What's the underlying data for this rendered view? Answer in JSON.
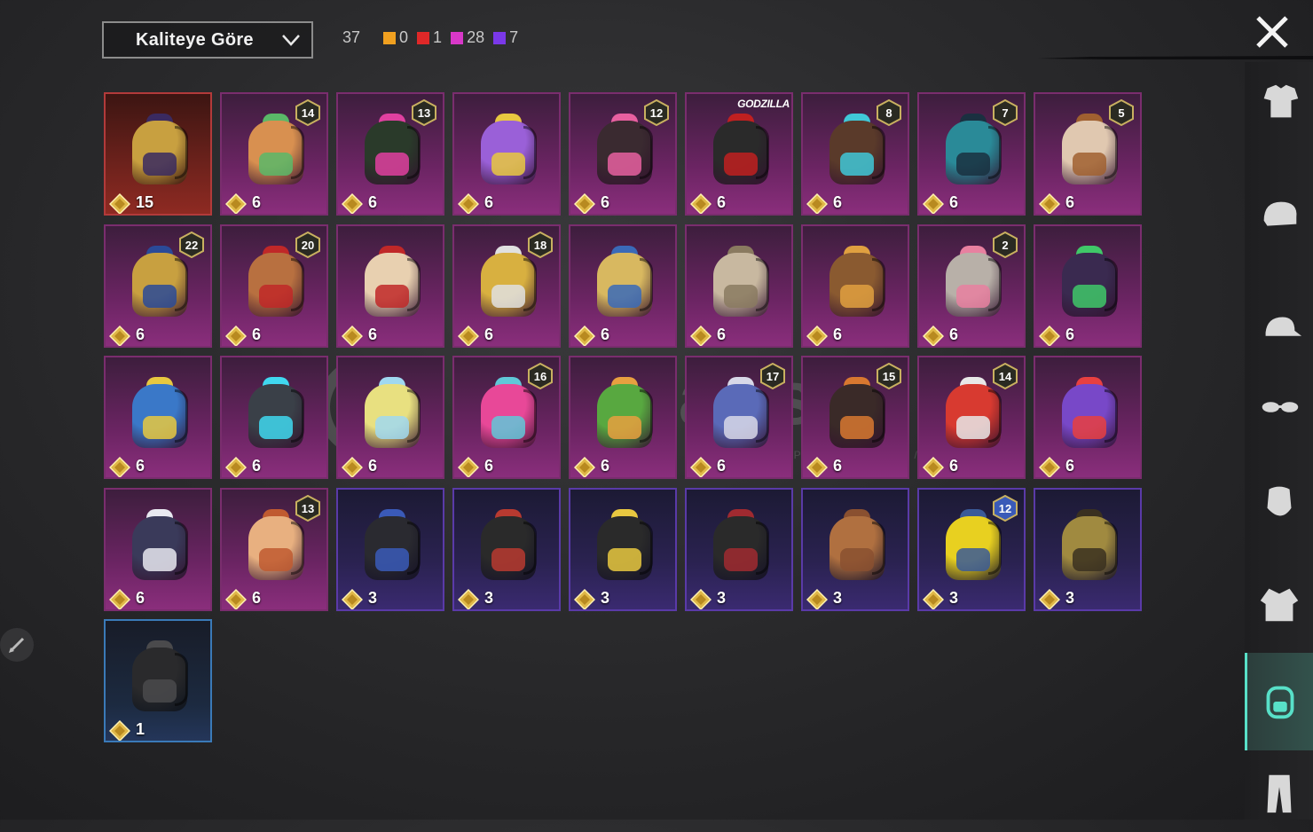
{
  "header": {
    "sort_label": "Kaliteye Göre",
    "total_count": "37",
    "quality_counts": [
      {
        "color": "#f0a020",
        "value": "0"
      },
      {
        "color": "#e02828",
        "value": "1"
      },
      {
        "color": "#d838c8",
        "value": "28"
      },
      {
        "color": "#7a38e8",
        "value": "7"
      }
    ]
  },
  "watermark": {
    "text": "itemsatis",
    "sub": "HESAP / SKIN / ITEM / EPIN",
    "domain": ".com"
  },
  "items": [
    {
      "value": "15",
      "level": "",
      "tier": "legendary",
      "color": "#c8a040",
      "accent": "#3a2a60",
      "tag": ""
    },
    {
      "value": "6",
      "level": "14",
      "tier": "mythic",
      "color": "#d89050",
      "accent": "#5ab868",
      "tag": ""
    },
    {
      "value": "6",
      "level": "13",
      "tier": "mythic",
      "color": "#2a3a2a",
      "accent": "#e040a0",
      "tag": ""
    },
    {
      "value": "6",
      "level": "",
      "tier": "mythic",
      "color": "#9a60d8",
      "accent": "#e8c840",
      "tag": ""
    },
    {
      "value": "6",
      "level": "12",
      "tier": "mythic",
      "color": "#3a2a30",
      "accent": "#e860a0",
      "tag": ""
    },
    {
      "value": "6",
      "level": "",
      "tier": "mythic",
      "color": "#2a2a2a",
      "accent": "#c02020",
      "tag": "GODZILLA"
    },
    {
      "value": "6",
      "level": "8",
      "tier": "mythic",
      "color": "#5a3a2a",
      "accent": "#40c8d8",
      "tag": ""
    },
    {
      "value": "6",
      "level": "7",
      "tier": "mythic",
      "color": "#2a8a98",
      "accent": "#1a3040",
      "tag": ""
    },
    {
      "value": "6",
      "level": "5",
      "tier": "mythic",
      "color": "#e0c8b0",
      "accent": "#a06030",
      "tag": ""
    },
    {
      "value": "6",
      "level": "22",
      "tier": "mythic",
      "color": "#c8a040",
      "accent": "#2a4a98",
      "tag": ""
    },
    {
      "value": "6",
      "level": "20",
      "tier": "mythic",
      "color": "#b87040",
      "accent": "#c02828",
      "tag": ""
    },
    {
      "value": "6",
      "level": "",
      "tier": "mythic",
      "color": "#e8d0b0",
      "accent": "#c02828",
      "tag": ""
    },
    {
      "value": "6",
      "level": "18",
      "tier": "mythic",
      "color": "#d8b040",
      "accent": "#e0e0e0",
      "tag": ""
    },
    {
      "value": "6",
      "level": "",
      "tier": "mythic",
      "color": "#d8b860",
      "accent": "#3a6ab8",
      "tag": ""
    },
    {
      "value": "6",
      "level": "",
      "tier": "mythic",
      "color": "#c8b8a0",
      "accent": "#8a7a60",
      "tag": ""
    },
    {
      "value": "6",
      "level": "",
      "tier": "mythic",
      "color": "#8a5a30",
      "accent": "#e0a040",
      "tag": ""
    },
    {
      "value": "6",
      "level": "2",
      "tier": "mythic",
      "color": "#b8b0a8",
      "accent": "#e880a0",
      "tag": ""
    },
    {
      "value": "6",
      "level": "",
      "tier": "mythic",
      "color": "#3a2a50",
      "accent": "#40c868",
      "tag": ""
    },
    {
      "value": "6",
      "level": "",
      "tier": "mythic",
      "color": "#3a78c8",
      "accent": "#e8c840",
      "tag": ""
    },
    {
      "value": "6",
      "level": "",
      "tier": "mythic",
      "color": "#3a4048",
      "accent": "#40d8f0",
      "tag": ""
    },
    {
      "value": "6",
      "level": "",
      "tier": "mythic",
      "color": "#e8e080",
      "accent": "#a0d8f0",
      "tag": ""
    },
    {
      "value": "6",
      "level": "16",
      "tier": "mythic",
      "color": "#e84898",
      "accent": "#60c8d8",
      "tag": ""
    },
    {
      "value": "6",
      "level": "",
      "tier": "mythic",
      "color": "#58a840",
      "accent": "#e8a040",
      "tag": ""
    },
    {
      "value": "6",
      "level": "17",
      "tier": "mythic",
      "color": "#5a6ab8",
      "accent": "#d8d8e8",
      "tag": ""
    },
    {
      "value": "6",
      "level": "15",
      "tier": "mythic",
      "color": "#3a2a28",
      "accent": "#d87830",
      "tag": ""
    },
    {
      "value": "6",
      "level": "14",
      "tier": "mythic",
      "color": "#d83a30",
      "accent": "#e8e8e8",
      "tag": ""
    },
    {
      "value": "6",
      "level": "",
      "tier": "mythic",
      "color": "#7848c8",
      "accent": "#e84040",
      "tag": ""
    },
    {
      "value": "6",
      "level": "",
      "tier": "mythic",
      "color": "#3a3a5a",
      "accent": "#e8e8f0",
      "tag": ""
    },
    {
      "value": "6",
      "level": "13",
      "tier": "mythic",
      "color": "#e8b080",
      "accent": "#c05a30",
      "tag": ""
    },
    {
      "value": "3",
      "level": "",
      "tier": "epic",
      "color": "#2a2a30",
      "accent": "#3a5ab8",
      "tag": ""
    },
    {
      "value": "3",
      "level": "",
      "tier": "epic",
      "color": "#2a2a2a",
      "accent": "#b83a30",
      "tag": ""
    },
    {
      "value": "3",
      "level": "",
      "tier": "epic",
      "color": "#2a2a2a",
      "accent": "#e8c840",
      "tag": ""
    },
    {
      "value": "3",
      "level": "",
      "tier": "epic",
      "color": "#2a2a2a",
      "accent": "#a02a30",
      "tag": ""
    },
    {
      "value": "3",
      "level": "",
      "tier": "epic",
      "color": "#b07040",
      "accent": "#8a5030",
      "tag": ""
    },
    {
      "value": "3",
      "level": "12",
      "tier": "epic",
      "color": "#e8d020",
      "accent": "#3a5a98",
      "tag": ""
    },
    {
      "value": "3",
      "level": "",
      "tier": "epic",
      "color": "#a08a40",
      "accent": "#3a3020",
      "tag": ""
    },
    {
      "value": "1",
      "level": "",
      "tier": "rare",
      "color": "#2a2a2c",
      "accent": "#4a4a4c",
      "tag": ""
    }
  ],
  "sidebar": [
    {
      "icon": "outfit-icon",
      "active": false
    },
    {
      "icon": "helmet-icon",
      "active": false
    },
    {
      "icon": "cap-icon",
      "active": false
    },
    {
      "icon": "glasses-icon",
      "active": false
    },
    {
      "icon": "mask-icon",
      "active": false
    },
    {
      "icon": "jacket-icon",
      "active": false
    },
    {
      "icon": "backpack-icon",
      "active": true
    },
    {
      "icon": "pants-icon",
      "active": false
    }
  ]
}
